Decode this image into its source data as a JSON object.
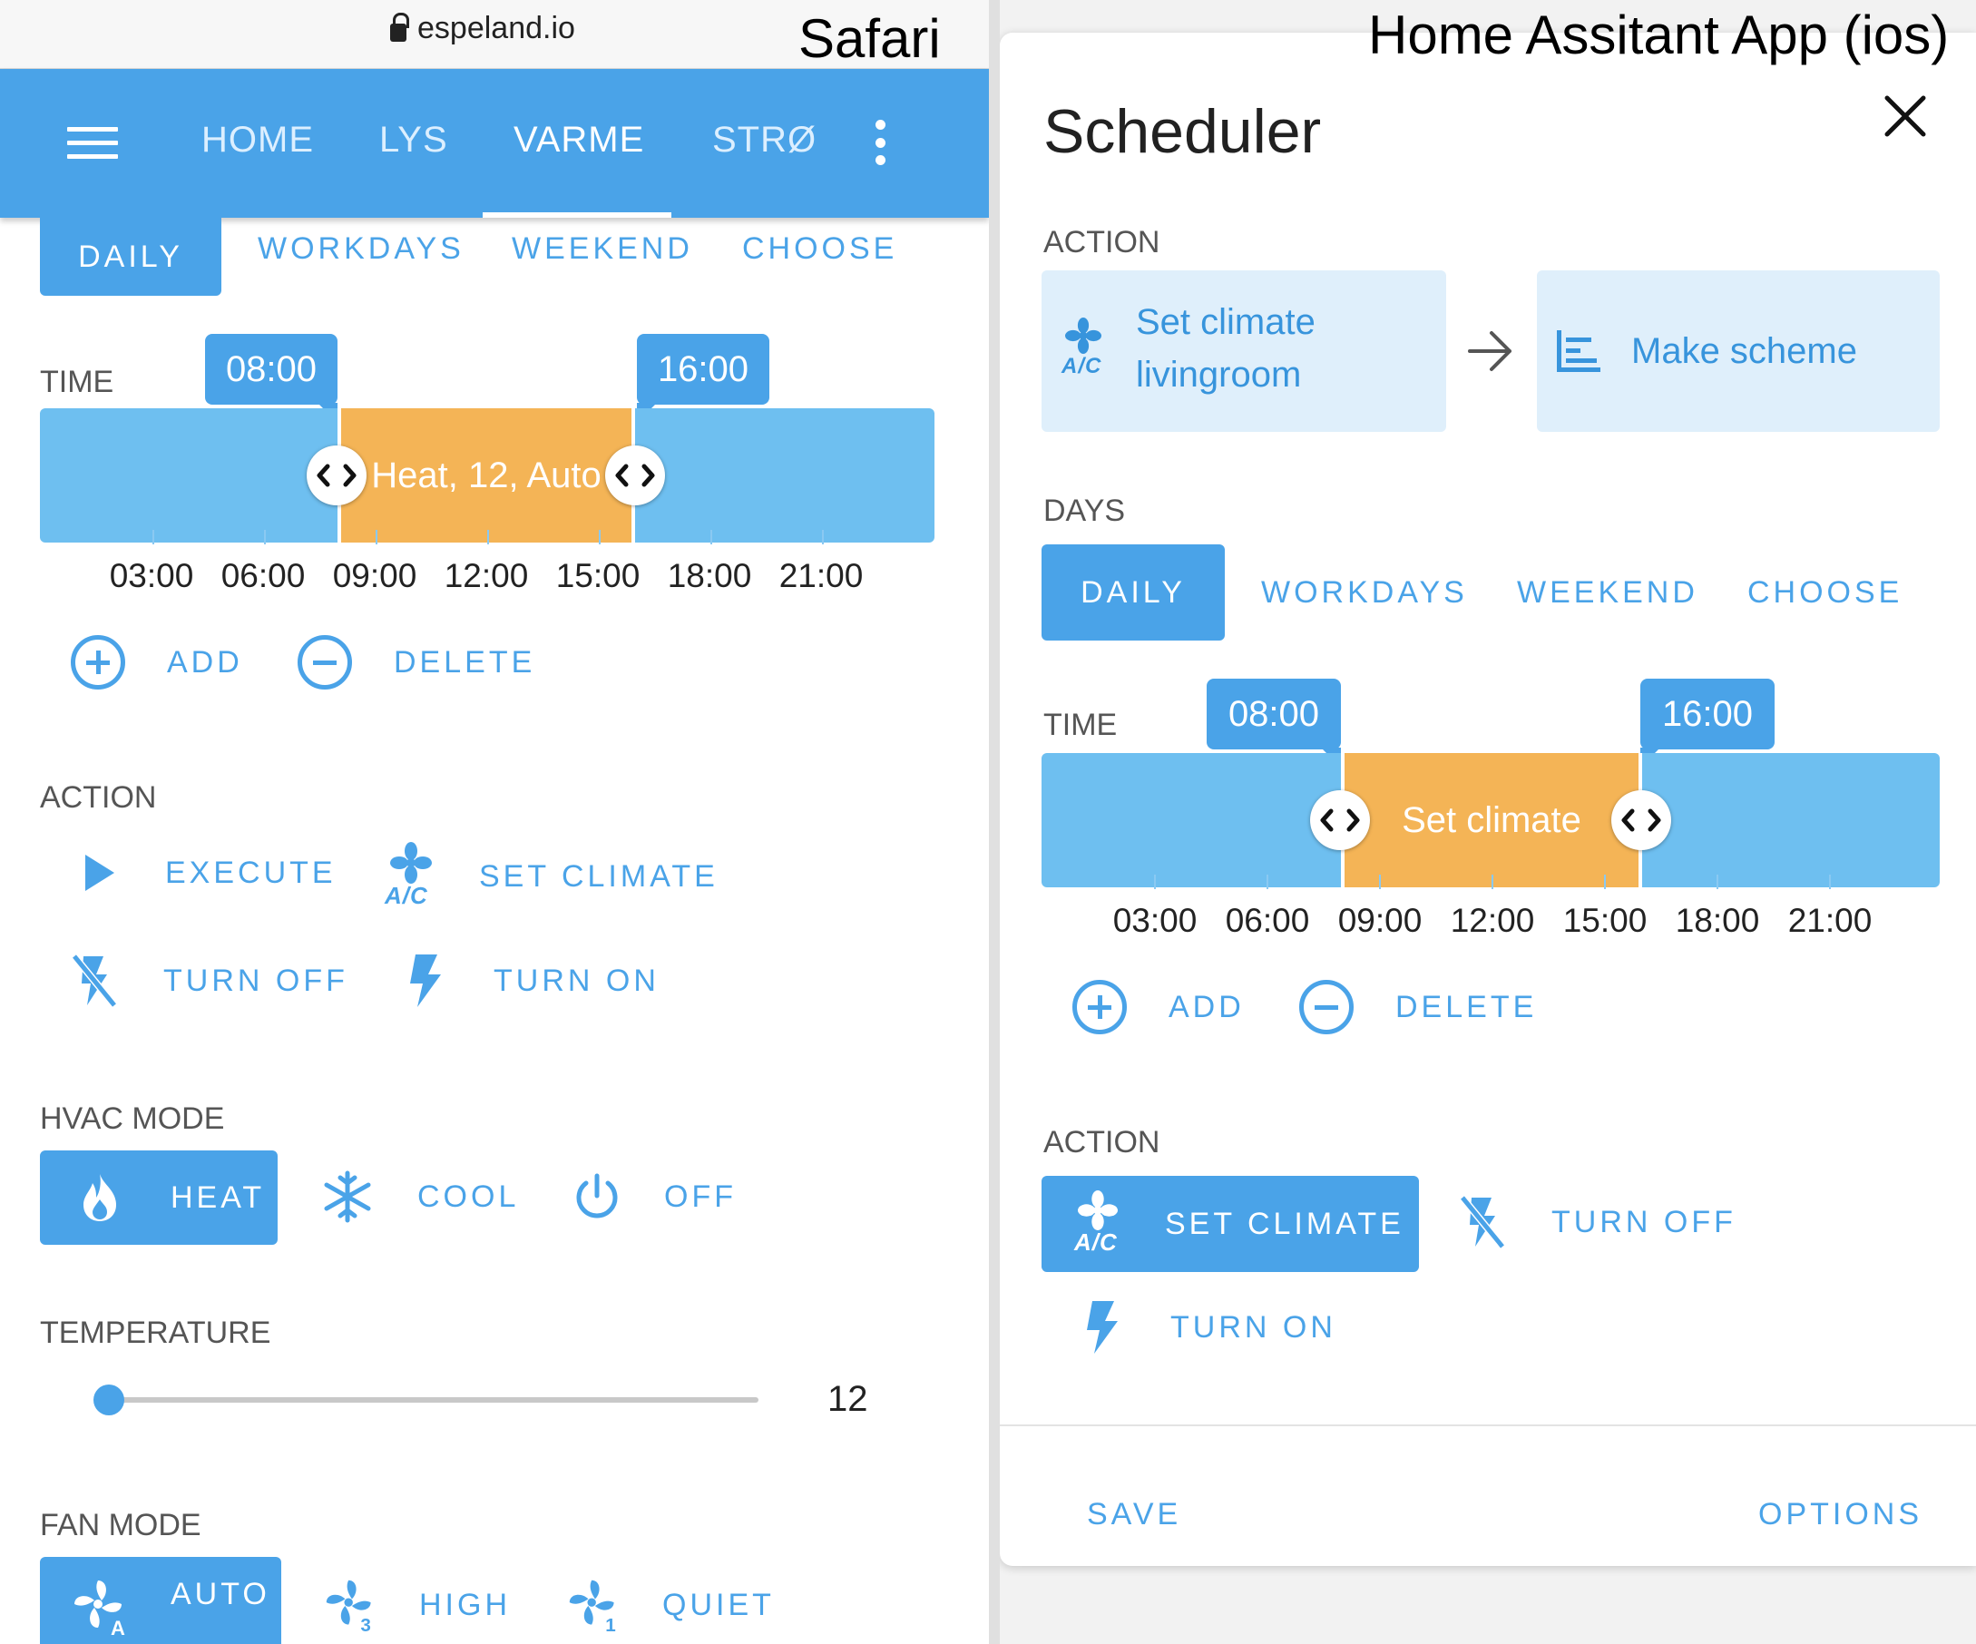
{
  "overlay_labels": {
    "left": "Safari",
    "right": "Home Assitant App (ios)"
  },
  "safari": {
    "url": "espeland.io"
  },
  "left": {
    "nav_tabs": [
      {
        "label": "HOME",
        "active": false
      },
      {
        "label": "LYS",
        "active": false
      },
      {
        "label": "VARME",
        "active": true
      },
      {
        "label": "STRØN",
        "active": false
      }
    ],
    "days_tabs": [
      "DAILY",
      "WORKDAYS",
      "WEEKEND",
      "CHOOSE"
    ],
    "time_label": "TIME",
    "timeline": {
      "start_tooltip": "08:00",
      "end_tooltip": "16:00",
      "slot_label": "Heat, 12, Auto",
      "ticks": [
        "03:00",
        "06:00",
        "09:00",
        "12:00",
        "15:00",
        "18:00",
        "21:00"
      ]
    },
    "add_label": "ADD",
    "delete_label": "DELETE",
    "action_label": "ACTION",
    "actions": {
      "execute": "EXECUTE",
      "set_climate": "SET CLIMATE",
      "turn_off": "TURN OFF",
      "turn_on": "TURN ON"
    },
    "hvac_label": "HVAC MODE",
    "hvac_modes": {
      "heat": "HEAT",
      "cool": "COOL",
      "off": "OFF"
    },
    "temperature_label": "TEMPERATURE",
    "temperature": {
      "value": "12",
      "fraction": 0.0
    },
    "fan_label": "FAN MODE",
    "fan_modes": {
      "auto": "AUTO",
      "high": "HIGH",
      "quiet": "QUIET"
    },
    "ac_icon_text": "A/C"
  },
  "dialog": {
    "title": "Scheduler",
    "action_label": "ACTION",
    "card_action": {
      "line1": "Set climate",
      "line2": "livingroom"
    },
    "card_scheme": "Make scheme",
    "days_label": "DAYS",
    "days_tabs": [
      "DAILY",
      "WORKDAYS",
      "WEEKEND",
      "CHOOSE"
    ],
    "time_label": "TIME",
    "timeline": {
      "start_tooltip": "08:00",
      "end_tooltip": "16:00",
      "slot_label": "Set climate",
      "ticks": [
        "03:00",
        "06:00",
        "09:00",
        "12:00",
        "15:00",
        "18:00",
        "21:00"
      ]
    },
    "add_label": "ADD",
    "delete_label": "DELETE",
    "action2_label": "ACTION",
    "actions": {
      "set_climate": "SET CLIMATE",
      "turn_off": "TURN OFF",
      "turn_on": "TURN ON"
    },
    "save_label": "SAVE",
    "options_label": "OPTIONS",
    "ac_icon_text": "A/C"
  },
  "colors": {
    "primary": "#4aa3e8",
    "slot": "#f4b456",
    "track": "#6ebff0"
  }
}
